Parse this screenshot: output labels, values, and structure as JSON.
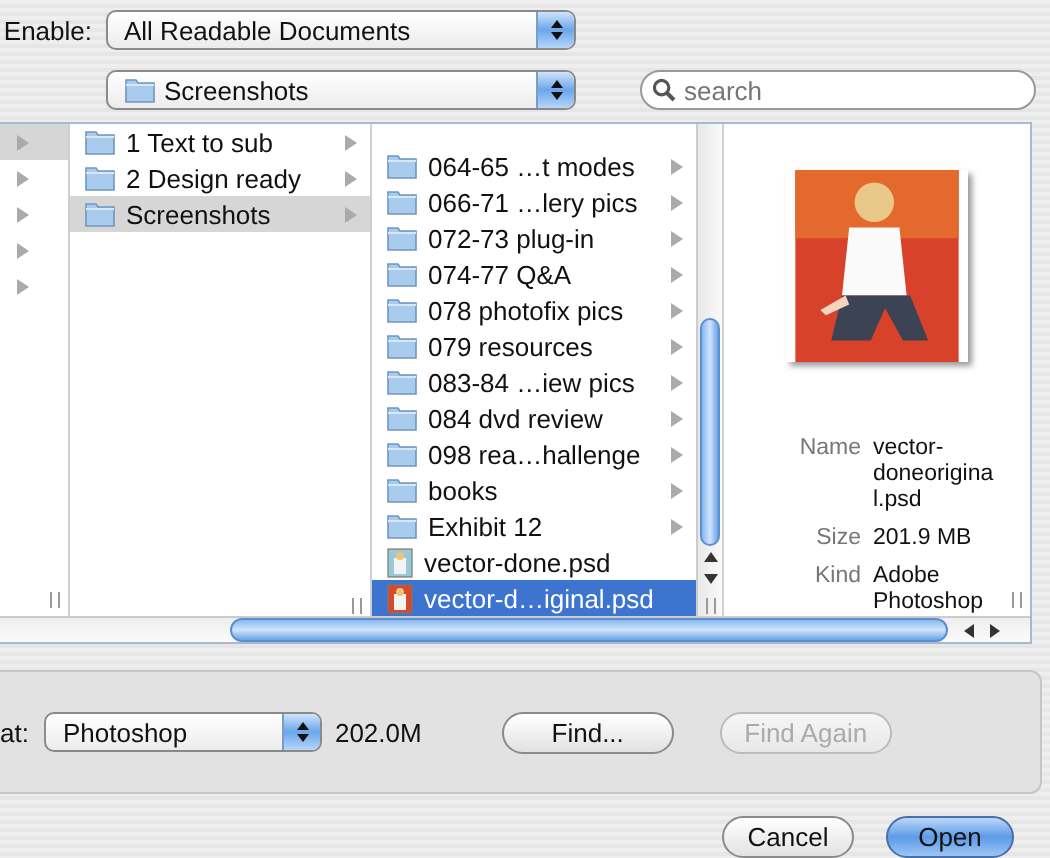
{
  "enable": {
    "label": "Enable:",
    "value": "All Readable Documents"
  },
  "location": {
    "value": "Screenshots"
  },
  "search": {
    "placeholder": "search"
  },
  "browser": {
    "column_1": [
      {
        "selected": true
      },
      {
        "selected": false
      },
      {
        "selected": false
      },
      {
        "selected": false
      },
      {
        "selected": false
      }
    ],
    "column_2": [
      {
        "name": "1 Text to sub",
        "kind": "folder",
        "selected": false
      },
      {
        "name": "2 Design ready",
        "kind": "folder",
        "selected": false
      },
      {
        "name": "Screenshots",
        "kind": "folder",
        "selected": true
      }
    ],
    "column_3": [
      {
        "name": "064-65 …t modes",
        "kind": "folder",
        "selected": false
      },
      {
        "name": "066-71 …lery pics",
        "kind": "folder",
        "selected": false
      },
      {
        "name": "072-73 plug-in",
        "kind": "folder",
        "selected": false
      },
      {
        "name": "074-77 Q&A",
        "kind": "folder",
        "selected": false
      },
      {
        "name": "078 photofix pics",
        "kind": "folder",
        "selected": false
      },
      {
        "name": "079 resources",
        "kind": "folder",
        "selected": false
      },
      {
        "name": "083-84 …iew pics",
        "kind": "folder",
        "selected": false
      },
      {
        "name": "084 dvd review",
        "kind": "folder",
        "selected": false
      },
      {
        "name": "098 rea…hallenge",
        "kind": "folder",
        "selected": false
      },
      {
        "name": "books",
        "kind": "folder",
        "selected": false
      },
      {
        "name": "Exhibit 12",
        "kind": "folder",
        "selected": false
      },
      {
        "name": "vector-done.psd",
        "kind": "file",
        "selected": false
      },
      {
        "name": "vector-d…iginal.psd",
        "kind": "file",
        "selected": true
      }
    ],
    "info": [
      {
        "label": "Name",
        "value": "vector-doneoriginal.psd"
      },
      {
        "label": "Size",
        "value": "201.9 MB"
      },
      {
        "label": "Kind",
        "value": "Adobe Photoshop"
      }
    ]
  },
  "format": {
    "label": "at:",
    "value": "Photoshop",
    "size": "202.0M"
  },
  "buttons": [
    {
      "label": "Find...",
      "disabled": false
    },
    {
      "label": "Find Again",
      "disabled": true
    }
  ],
  "actions": [
    {
      "label": "Cancel",
      "default": false
    },
    {
      "label": "Open",
      "default": true
    }
  ]
}
